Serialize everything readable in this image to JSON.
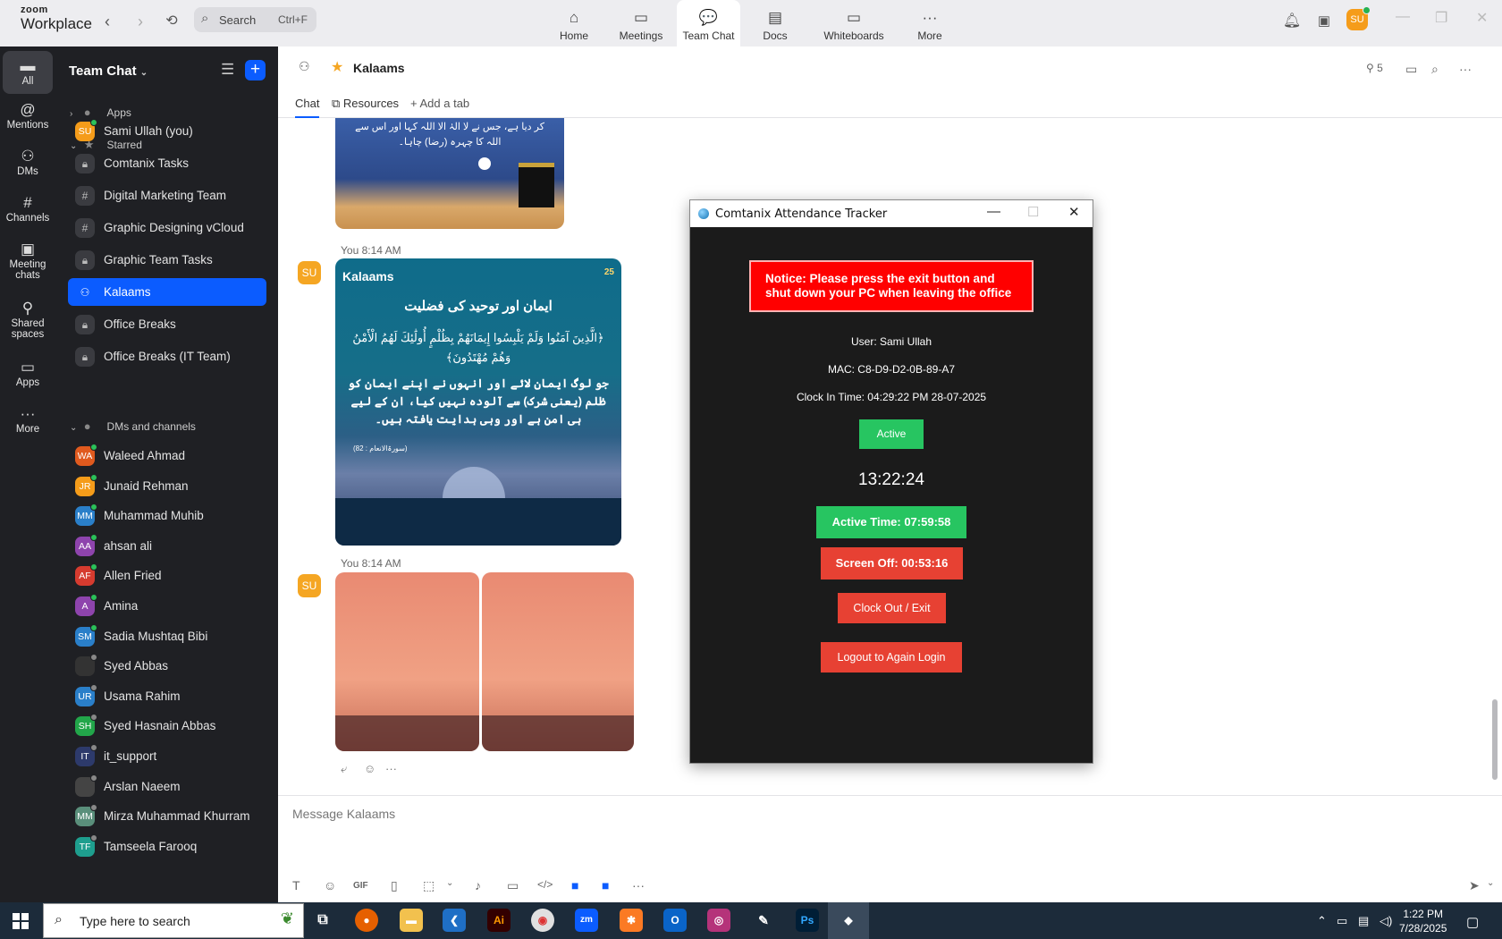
{
  "app": {
    "logo_line1": "zoom",
    "logo_line2": "Workplace"
  },
  "search": {
    "placeholder": "Search",
    "shortcut": "Ctrl+F"
  },
  "nav": [
    {
      "label": "Home"
    },
    {
      "label": "Meetings"
    },
    {
      "label": "Team Chat"
    },
    {
      "label": "Docs"
    },
    {
      "label": "Whiteboards"
    },
    {
      "label": "More"
    }
  ],
  "user_avatar": "SU",
  "rail": [
    {
      "label": "All"
    },
    {
      "label": "Mentions"
    },
    {
      "label": "DMs"
    },
    {
      "label": "Channels"
    },
    {
      "label": "Meeting chats"
    },
    {
      "label": "Shared spaces"
    },
    {
      "label": "Apps"
    },
    {
      "label": "More"
    }
  ],
  "sidebar": {
    "title": "Team Chat",
    "sections": {
      "apps": "Apps",
      "starred": "Starred",
      "dms": "DMs and channels"
    },
    "starred": [
      {
        "label": "Sami Ullah (you)",
        "initials": "SU",
        "color": "#f59c1a",
        "kind": "avatar"
      },
      {
        "label": "Comtanix Tasks",
        "kind": "lock"
      },
      {
        "label": "Digital Marketing Team",
        "kind": "hash"
      },
      {
        "label": "Graphic Designing vCloud",
        "kind": "hash"
      },
      {
        "label": "Graphic Team Tasks",
        "kind": "lock"
      },
      {
        "label": "Kalaams",
        "kind": "group"
      },
      {
        "label": "Office Breaks",
        "kind": "lock"
      },
      {
        "label": "Office Breaks (IT Team)",
        "kind": "lock"
      }
    ],
    "dms": [
      {
        "label": "Waleed Ahmad",
        "initials": "WA",
        "color": "#e05a1e"
      },
      {
        "label": "Junaid Rehman",
        "initials": "JR",
        "color": "#f59c1a"
      },
      {
        "label": "Muhammad Muhib",
        "initials": "MM",
        "color": "#2a7fc9"
      },
      {
        "label": "ahsan ali",
        "initials": "AA",
        "color": "#8e44ad"
      },
      {
        "label": "Allen Fried",
        "initials": "AF",
        "color": "#d63b2f"
      },
      {
        "label": "Amina",
        "initials": "A",
        "color": "#8e44ad"
      },
      {
        "label": "Sadia Mushtaq Bibi",
        "initials": "SM",
        "color": "#2a7fc9"
      },
      {
        "label": "Syed Abbas",
        "initials": "",
        "color": "#333"
      },
      {
        "label": "Usama Rahim",
        "initials": "UR",
        "color": "#2a7fc9"
      },
      {
        "label": "Syed Hasnain Abbas",
        "initials": "SH",
        "color": "#22a64a"
      },
      {
        "label": "it_support",
        "initials": "IT",
        "color": "#2d3a6b"
      },
      {
        "label": "Arslan Naeem",
        "initials": "",
        "color": "#444"
      },
      {
        "label": "Mirza Muhammad Khurram",
        "initials": "MM",
        "color": "#5a8f7b"
      },
      {
        "label": "Tamseela Farooq",
        "initials": "TF",
        "color": "#1e9e8e"
      }
    ]
  },
  "channel": {
    "name": "Kalaams",
    "member_count": "5",
    "tabs": {
      "chat": "Chat",
      "resources": "Resources",
      "add": "Add a tab"
    },
    "messages": [
      {
        "time": "You 8:14 AM",
        "author_initials": "SU"
      },
      {
        "time": "You 8:14 AM",
        "author_initials": "SU"
      }
    ],
    "post1": {
      "brand": "Kalaams",
      "badge": "25",
      "heading": "ایمان اور توحید کی فضلیت",
      "arabic": "﴿الَّذِينَ آمَنُوا وَلَمْ يَلْبِسُوا إِيمَانَهُمْ بِظُلْمٍ أُولَٰئِكَ لَهُمُ الْأَمْنُ وَهُمْ مُهْتَدُونَ﴾",
      "urdu": "جو لوگ ایمان لائے اور انہوں نے اپنے ایمان کو ظلم (یعنی شرک) سے آلودہ نہیں کیا، ان کے لیے ہی امن ہے اور وہی ہدایت یافتہ ہیں۔",
      "ref": "(سورۃالانعام : 82)"
    },
    "top_post_snippet": "کر دیا ہے، جس نے لا الہٰ الا اللہ کہا اور اس سے اللہ کا چہرہ (رضا) چاہا۔",
    "composer_placeholder": "Message Kalaams"
  },
  "attendance": {
    "title": "Comtanix Attendance Tracker",
    "notice": "Notice: Please press the exit button and shut down your PC when leaving the office",
    "user": "User: Sami Ullah",
    "mac": "MAC: C8-D9-D2-0B-89-A7",
    "clock_in": "Clock In Time: 04:29:22 PM 28-07-2025",
    "status": "Active",
    "timer": "13:22:24",
    "active_time": "Active Time: 07:59:58",
    "screen_off": "Screen Off: 00:53:16",
    "clock_out": "Clock Out / Exit",
    "logout": "Logout to Again Login",
    "colors": {
      "green": "#27c561",
      "red": "#e74133",
      "notice_red": "#ff0000"
    }
  },
  "taskbar": {
    "search_placeholder": "Type here to search",
    "time": "1:22 PM",
    "date": "7/28/2025"
  }
}
